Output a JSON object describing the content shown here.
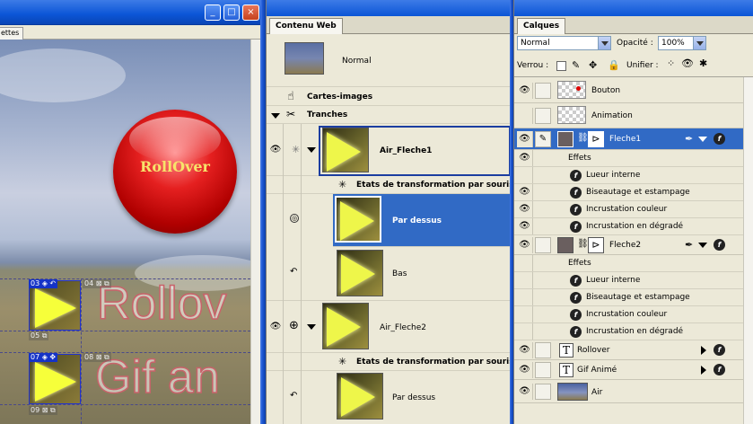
{
  "document": {
    "tab_label": "ettes",
    "button_text": "RollOver",
    "big_text_1": "Rollov",
    "big_text_2": "Gif an",
    "slices": [
      {
        "num": "03",
        "next": "04"
      },
      {
        "num": "05"
      },
      {
        "num": "07",
        "next": "08"
      },
      {
        "num": "09"
      }
    ]
  },
  "web_panel": {
    "tab": "Contenu Web",
    "page_label": "Normal",
    "image_maps": "Cartes-images",
    "slices_label": "Tranches",
    "rows": [
      {
        "name": "Air_Fleche1"
      },
      {
        "name": "Etats de transformation par souris"
      },
      {
        "name": "Par dessus"
      },
      {
        "name": "Bas"
      },
      {
        "name": "Air_Fleche2"
      },
      {
        "name": "Etats de transformation par souris"
      },
      {
        "name": "Par dessus"
      }
    ]
  },
  "layers_panel": {
    "tab": "Calques",
    "blend_mode": "Normal",
    "opacity_label": "Opacité :",
    "opacity_value": "100%",
    "lock_label": "Verrou :",
    "unify_label": "Unifier :",
    "layers": [
      {
        "name": "Bouton"
      },
      {
        "name": "Animation"
      },
      {
        "name": "Fleche1"
      },
      {
        "name": "Effets"
      },
      {
        "name": "Lueur interne"
      },
      {
        "name": "Biseautage et estampage"
      },
      {
        "name": "Incrustation couleur"
      },
      {
        "name": "Incrustation en dégradé"
      },
      {
        "name": "Fleche2"
      },
      {
        "name": "Effets"
      },
      {
        "name": "Lueur interne"
      },
      {
        "name": "Biseautage et estampage"
      },
      {
        "name": "Incrustation couleur"
      },
      {
        "name": "Incrustation en dégradé"
      },
      {
        "name": "Rollover"
      },
      {
        "name": "Gif Animé"
      },
      {
        "name": "Air"
      }
    ]
  },
  "icons": {
    "minimize": "minimize-icon",
    "maximize": "maximize-icon",
    "close": "close-icon",
    "eye": "eye-icon",
    "fx": "fx-icon"
  },
  "colors": {
    "title_bar": "#0b55d6",
    "selection": "#316ac5",
    "panel_bg": "#ece9d8"
  }
}
